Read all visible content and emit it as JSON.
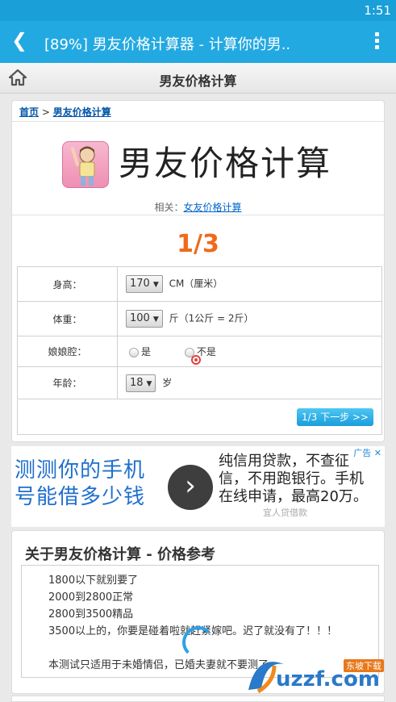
{
  "status": {
    "time": "1:51"
  },
  "appbar": {
    "title": "[89%] 男友价格计算器 - 计算你的男.."
  },
  "header": {
    "title": "男友价格计算"
  },
  "breadcrumb": {
    "home": "首页",
    "sep": " > ",
    "current": "男友价格计算"
  },
  "main": {
    "title": "男友价格计算",
    "related_label": "相关：",
    "related_link": "女友价格计算",
    "step": "1/3"
  },
  "form": {
    "height": {
      "label": "身高：",
      "value": "170",
      "unit": "CM（厘米）"
    },
    "weight": {
      "label": "体重：",
      "value": "100",
      "unit": "斤（1公斤 = 2斤）"
    },
    "voice": {
      "label": "娘娘腔：",
      "opt_yes": "是",
      "opt_no": "不是"
    },
    "age": {
      "label": "年龄：",
      "value": "18",
      "unit": "岁"
    },
    "next": "1/3 下一步 >>"
  },
  "ad": {
    "tag": "广告",
    "left_line1": "测测你的手机",
    "left_line2": "号能借多少钱",
    "right_line1": "纯信用贷款，不查征",
    "right_line2": "信，不用跑银行。手机",
    "right_line3": "在线申请，最高20万。",
    "brand": "宜人贷借款"
  },
  "about": {
    "title": "关于男友价格计算 - 价格参考",
    "lines": [
      "1800以下就别要了",
      "2000到2800正常",
      "2800到3500精品",
      "3500以上的，你要是碰着啦就赶紧嫁吧。迟了就没有了！！！",
      "",
      "本测试只适用于未婚情侣，已婚夫妻就不要测了"
    ]
  },
  "watermark": {
    "text": "uzzf.com",
    "sub": "东坡下载"
  },
  "colors": {
    "appbar": "#23a9e1",
    "step": "#f06a1a",
    "link": "#0055aa",
    "button": "#1a9ddc"
  }
}
